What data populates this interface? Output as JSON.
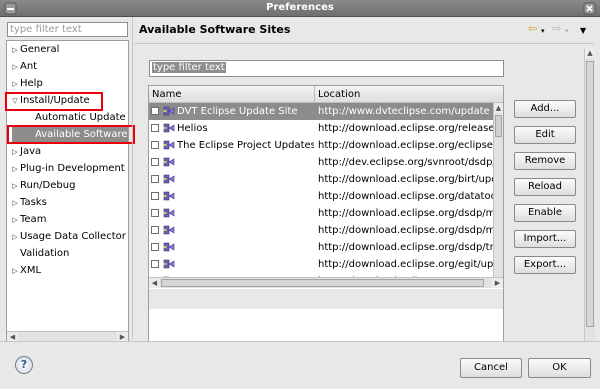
{
  "window": {
    "title": "Preferences"
  },
  "left": {
    "filter_placeholder": "type filter text",
    "tree": [
      {
        "label": "General",
        "arrow": "▷",
        "indent": 0
      },
      {
        "label": "Ant",
        "arrow": "▷",
        "indent": 0
      },
      {
        "label": "Help",
        "arrow": "▷",
        "indent": 0
      },
      {
        "label": "Install/Update",
        "arrow": "▽",
        "indent": 0
      },
      {
        "label": "Automatic Update",
        "arrow": "",
        "indent": 1
      },
      {
        "label": "Available Software",
        "arrow": "",
        "indent": 1,
        "selected": true
      },
      {
        "label": "Java",
        "arrow": "▷",
        "indent": 0
      },
      {
        "label": "Plug-in Development",
        "arrow": "▷",
        "indent": 0
      },
      {
        "label": "Run/Debug",
        "arrow": "▷",
        "indent": 0
      },
      {
        "label": "Tasks",
        "arrow": "▷",
        "indent": 0
      },
      {
        "label": "Team",
        "arrow": "▷",
        "indent": 0
      },
      {
        "label": "Usage Data Collector",
        "arrow": "▷",
        "indent": 0
      },
      {
        "label": "Validation",
        "arrow": "",
        "indent": 0
      },
      {
        "label": "XML",
        "arrow": "▷",
        "indent": 0
      }
    ]
  },
  "page": {
    "title": "Available Software Sites",
    "filter_text": "type filter text",
    "table": {
      "columns": [
        "Name",
        "Location"
      ],
      "rows": [
        {
          "name": "DVT Eclipse Update Site",
          "location": "http://www.dvteclipse.com/update",
          "selected": true
        },
        {
          "name": "Helios",
          "location": "http://download.eclipse.org/releases/h"
        },
        {
          "name": "The Eclipse Project Updates",
          "location": "http://download.eclipse.org/eclipse/up"
        },
        {
          "name": "",
          "location": "http://dev.eclipse.org/svnroot/dsdp/org"
        },
        {
          "name": "",
          "location": "http://download.eclipse.org/birt/updat"
        },
        {
          "name": "",
          "location": "http://download.eclipse.org/datatools/"
        },
        {
          "name": "",
          "location": "http://download.eclipse.org/dsdp/mtj/u"
        },
        {
          "name": "",
          "location": "http://download.eclipse.org/dsdp/mtj/u"
        },
        {
          "name": "",
          "location": "http://download.eclipse.org/dsdp/tm/u"
        },
        {
          "name": "",
          "location": "http://download.eclipse.org/egit/updat"
        },
        {
          "name": "",
          "location": "http://download.eclipse.org/mat/1.0/u"
        }
      ]
    },
    "buttons": {
      "add": "Add...",
      "edit": "Edit",
      "remove": "Remove",
      "reload": "Reload",
      "enable": "Enable",
      "import": "Import...",
      "export": "Export..."
    }
  },
  "footer": {
    "help": "?",
    "cancel": "Cancel",
    "ok": "OK"
  },
  "colors": {
    "highlight": "#e8000c",
    "selection": "#8c8c8b"
  }
}
